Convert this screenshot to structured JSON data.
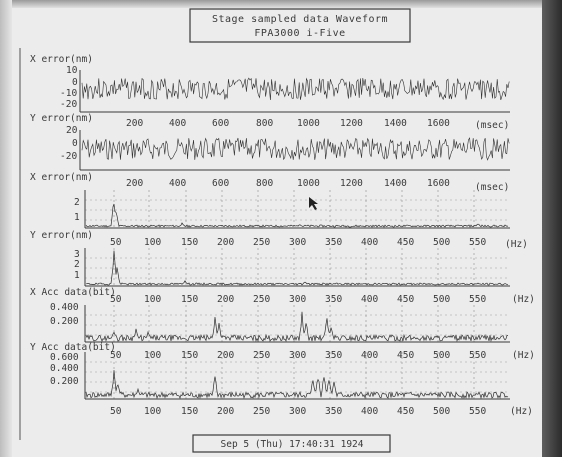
{
  "header": {
    "title_line1": "Stage sampled data Waveform",
    "title_line2": "FPA3000 i-Five"
  },
  "footer": {
    "status": "Sep  5 (Thu) 17:40:31 1924"
  },
  "panels": [
    {
      "label": "X error(nm)",
      "yticks": [
        "10",
        "0",
        "-10",
        "-20"
      ],
      "xticks": [
        "200",
        "400",
        "600",
        "800",
        "1000",
        "1200",
        "1400",
        "1600"
      ],
      "unit": "(msec)"
    },
    {
      "label": "Y error(nm)",
      "yticks": [
        "20",
        "0",
        "-20"
      ],
      "xticks": [
        "200",
        "400",
        "600",
        "800",
        "1000",
        "1200",
        "1400",
        "1600"
      ],
      "unit": "(msec)"
    },
    {
      "label": "X error(nm)",
      "yticks": [
        "2",
        "1"
      ],
      "xticks": [
        "50",
        "100",
        "150",
        "200",
        "250",
        "300",
        "350",
        "400",
        "450",
        "500",
        "550"
      ],
      "unit": "(Hz)"
    },
    {
      "label": "Y error(nm)",
      "yticks": [
        "3",
        "2",
        "1"
      ],
      "xticks": [
        "50",
        "100",
        "150",
        "200",
        "250",
        "300",
        "350",
        "400",
        "450",
        "500",
        "550"
      ],
      "unit": "(Hz)"
    },
    {
      "label": "X Acc data(bit)",
      "yticks": [
        "0.400",
        "0.200"
      ],
      "xticks": [
        "50",
        "100",
        "150",
        "200",
        "250",
        "300",
        "350",
        "400",
        "450",
        "500",
        "550"
      ],
      "unit": "(Hz)"
    },
    {
      "label": "Y Acc data(bit)",
      "yticks": [
        "0.600",
        "0.400",
        "0.200"
      ],
      "xticks": [
        "50",
        "100",
        "150",
        "200",
        "250",
        "300",
        "350",
        "400",
        "450",
        "500",
        "550"
      ],
      "unit": "(Hz)"
    }
  ],
  "colors": {
    "screen": "#ececec",
    "ink": "#3a3a3a",
    "grid": "#9a9a9a"
  }
}
